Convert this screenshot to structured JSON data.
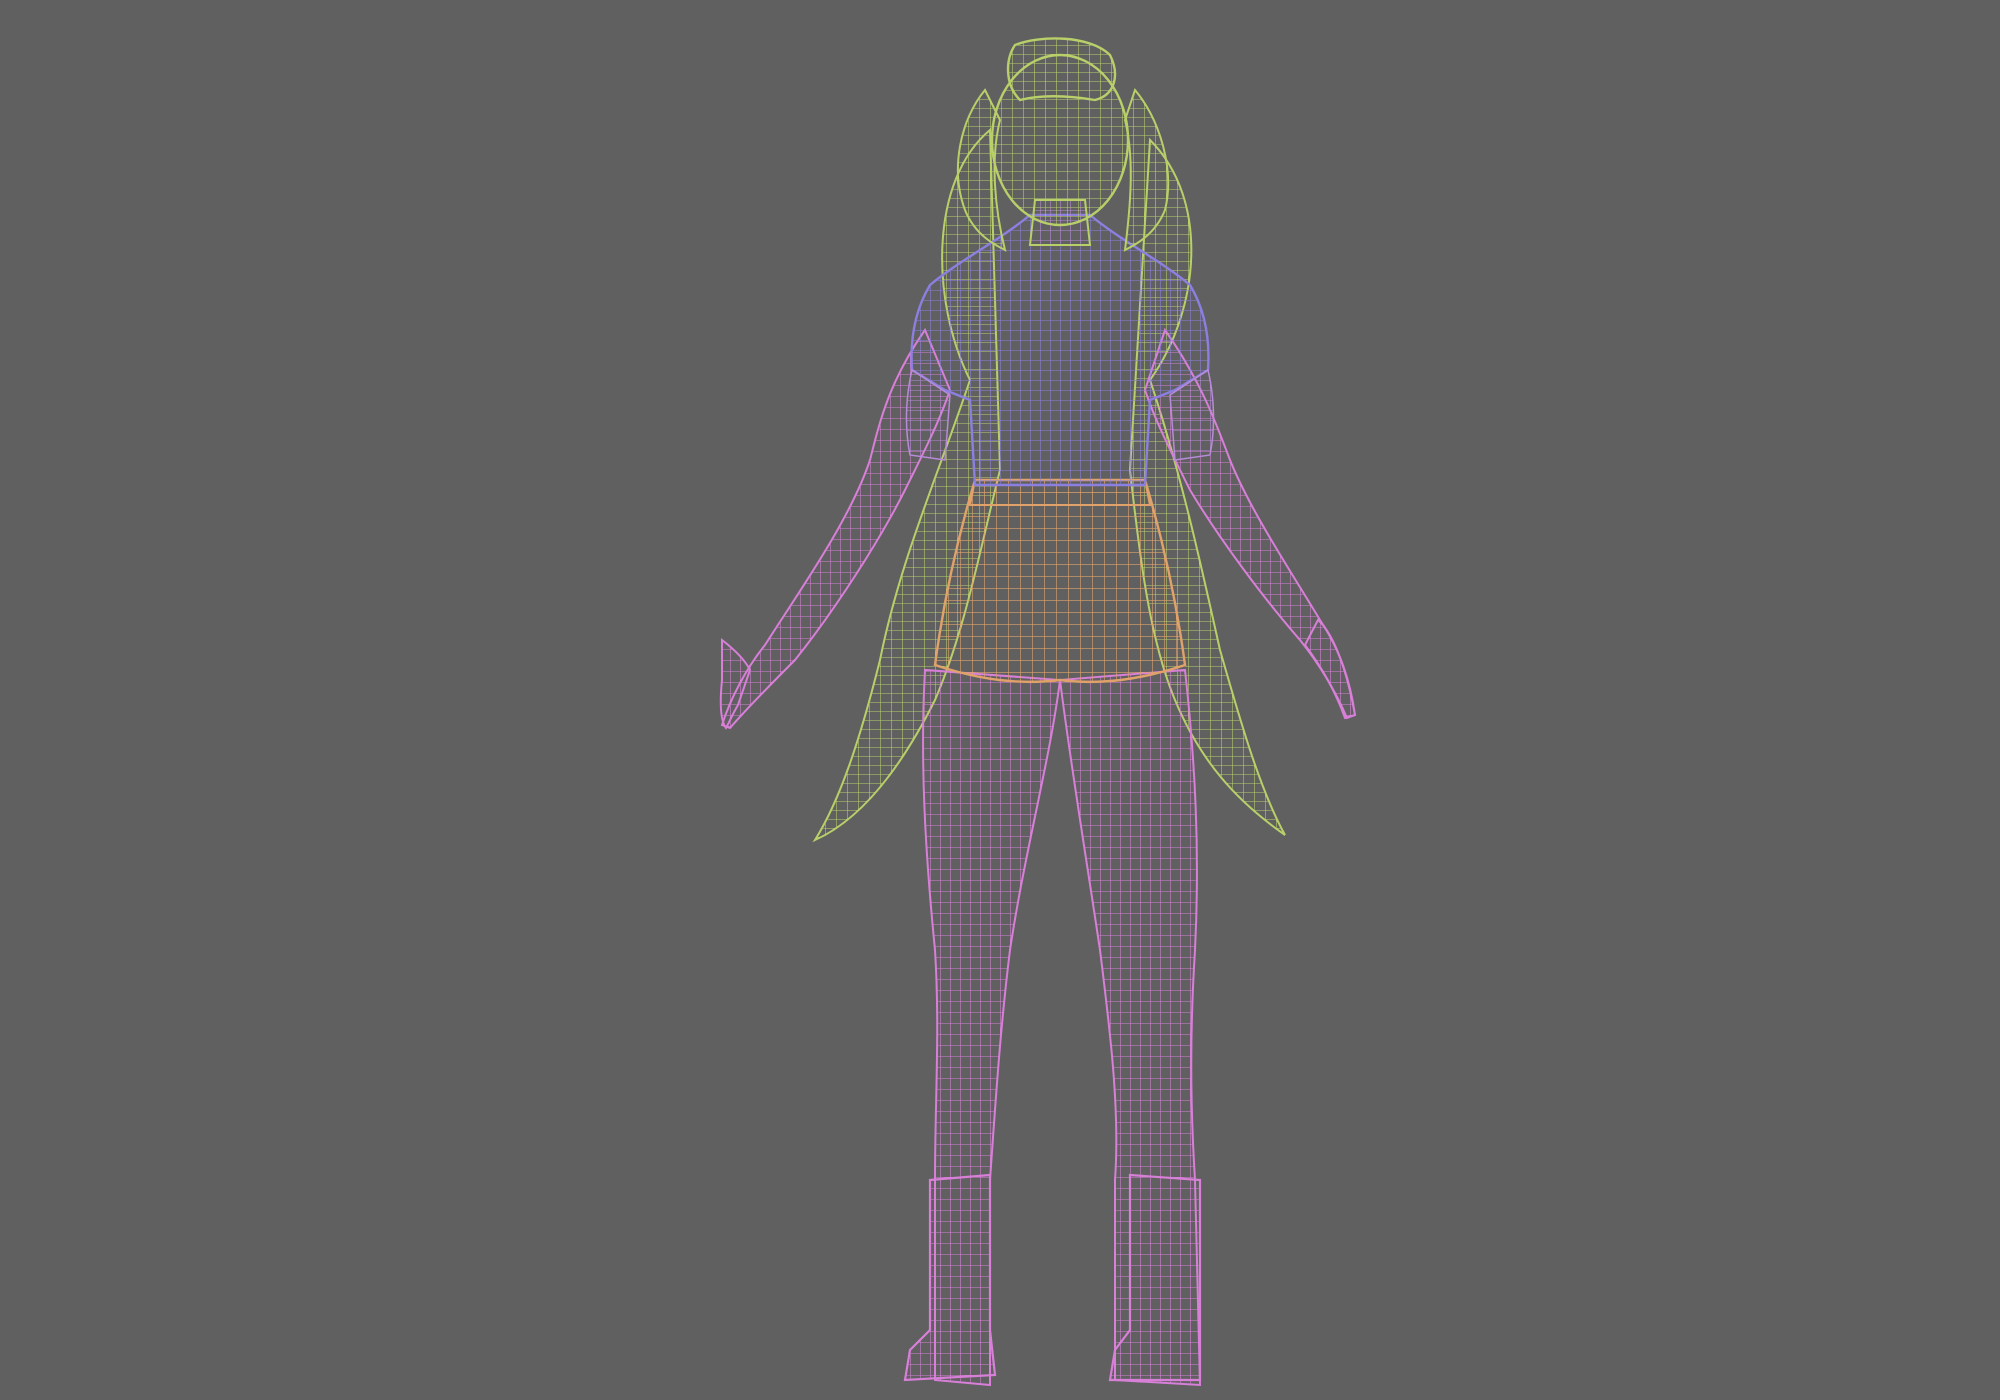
{
  "viewport": {
    "background": "#606060",
    "view": "back",
    "shading": "wireframe"
  },
  "model": {
    "parts": [
      {
        "name": "hair",
        "color": "#b8cf6a"
      },
      {
        "name": "shirt",
        "color": "#8b7fe0"
      },
      {
        "name": "shorts",
        "color": "#e0a26a"
      },
      {
        "name": "skin",
        "color": "#d87fd8"
      }
    ]
  }
}
